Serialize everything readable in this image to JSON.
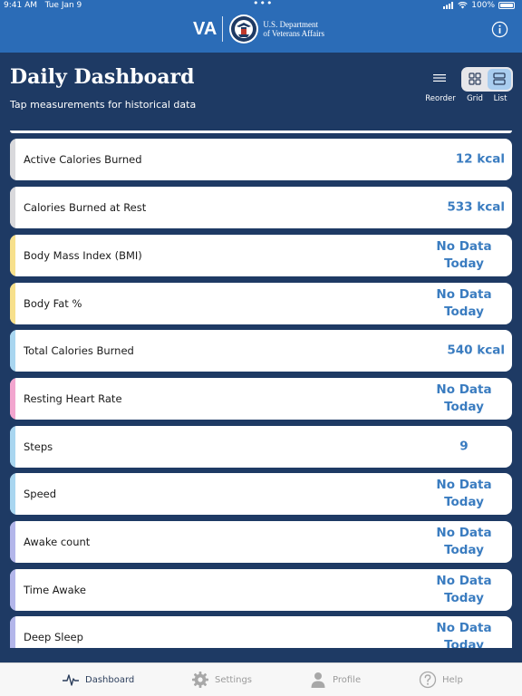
{
  "status": {
    "time": "9:41 AM",
    "date": "Tue Jan 9",
    "battery": "100%"
  },
  "header": {
    "brand": "VA",
    "dept_line1": "U.S. Department",
    "dept_line2": "of Veterans Affairs"
  },
  "dashboard": {
    "title": "Daily Dashboard",
    "subtitle": "Tap measurements for historical data",
    "reorder_label": "Reorder",
    "grid_label": "Grid",
    "list_label": "List"
  },
  "colors": {
    "header_blue": "#2b6cb7",
    "navy": "#1e3a64",
    "value_blue": "#3a7cc0",
    "gray": "#d9d9dc",
    "yellow": "#f7e08c",
    "light_blue": "#a9d6f0",
    "pink": "#f2a6cf",
    "lavender": "#b3b6ea"
  },
  "metrics": [
    {
      "label": "Active Calories Burned",
      "value": "12 kcal",
      "color": "gray"
    },
    {
      "label": "Calories Burned at Rest",
      "value": "533 kcal",
      "color": "gray"
    },
    {
      "label": "Body Mass Index (BMI)",
      "value_line1": "No Data",
      "value_line2": "Today",
      "color": "yellow"
    },
    {
      "label": "Body Fat %",
      "value_line1": "No Data",
      "value_line2": "Today",
      "color": "yellow"
    },
    {
      "label": "Total Calories Burned",
      "value": "540 kcal",
      "color": "light_blue"
    },
    {
      "label": "Resting Heart Rate",
      "value_line1": "No Data",
      "value_line2": "Today",
      "color": "pink"
    },
    {
      "label": "Steps",
      "value": "9",
      "color": "light_blue"
    },
    {
      "label": "Speed",
      "value_line1": "No Data",
      "value_line2": "Today",
      "color": "light_blue"
    },
    {
      "label": "Awake count",
      "value_line1": "No Data",
      "value_line2": "Today",
      "color": "lavender"
    },
    {
      "label": "Time Awake",
      "value_line1": "No Data",
      "value_line2": "Today",
      "color": "lavender"
    },
    {
      "label": "Deep Sleep",
      "value_line1": "No Data",
      "value_line2": "Today",
      "color": "lavender"
    }
  ],
  "tabs": [
    {
      "label": "Dashboard",
      "icon": "pulse-icon",
      "active": true
    },
    {
      "label": "Settings",
      "icon": "gear-icon",
      "active": false
    },
    {
      "label": "Profile",
      "icon": "person-icon",
      "active": false
    },
    {
      "label": "Help",
      "icon": "question-icon",
      "active": false
    }
  ]
}
